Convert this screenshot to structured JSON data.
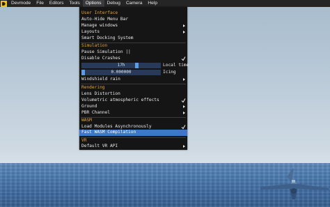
{
  "menubar": {
    "items": [
      "Devmode",
      "File",
      "Editors",
      "Tools",
      "Options",
      "Debug",
      "Camera",
      "Help"
    ],
    "active_index": 4
  },
  "options_menu": {
    "user_interface": {
      "header": "User Interface",
      "auto_hide": "Auto-Hide Menu Bar",
      "manage_windows": "Manage windows",
      "layouts": "Layouts",
      "smart_docking": "Smart Docking System"
    },
    "simulation": {
      "header": "Simulation",
      "pause": "Pause Simulation ||",
      "disable_crashes": "Disable Crashes",
      "local_time_value": "17h",
      "local_time_label": "Local time",
      "local_time_fraction": 0.71,
      "icing_value": "0.000000",
      "icing_label": "Icing",
      "icing_fraction": 0.0,
      "windshield_rain": "Windshield rain"
    },
    "rendering": {
      "header": "Rendering",
      "lens_distortion": "Lens Distortion",
      "volumetric": "Volumetric atmospheric effects",
      "ground": "Ground",
      "pbr_channel": "PBR Channel"
    },
    "wasm": {
      "header": "WASM",
      "load_modules": "Load Modules Asynchronously",
      "fast_compilation": "Fast WASM Compilation"
    },
    "vr": {
      "header": "VR",
      "default_api": "Default VR API"
    }
  },
  "colors": {
    "menubar_bg": "#252526",
    "menu_bg": "#151515",
    "section_header": "#e2a23a",
    "highlight": "#3d78c6",
    "slider_track": "#273a5a",
    "slider_thumb": "#5d9bea"
  }
}
